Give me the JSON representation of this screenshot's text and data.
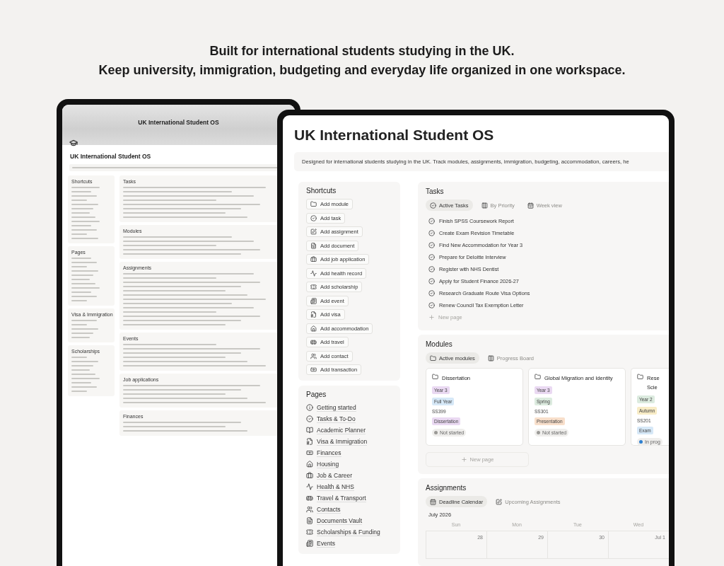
{
  "headline": [
    "Built for international students studying in the UK.",
    "Keep university, immigration, budgeting and everyday life organized in one workspace."
  ],
  "back_tablet": {
    "banner_title": "UK International Student OS",
    "page_title": "UK International Student OS",
    "sidebar": [
      {
        "title": "Shortcuts"
      },
      {
        "title": "Pages"
      },
      {
        "title": "Visa & Immigration"
      },
      {
        "title": "Scholarships"
      }
    ],
    "main": [
      {
        "title": "Tasks"
      },
      {
        "title": "Modules"
      },
      {
        "title": "Assignments"
      },
      {
        "title": "Events"
      },
      {
        "title": "Job applications"
      },
      {
        "title": "Finances"
      }
    ]
  },
  "front_tablet": {
    "title": "UK International Student OS",
    "description": "Designed for international students studying in the UK. Track modules, assignments, immigration, budgeting, accommodation, careers, he",
    "shortcuts": {
      "title": "Shortcuts",
      "items": [
        "Add module",
        "Add task",
        "Add assignment",
        "Add document",
        "Add job application",
        "Add health record",
        "Add scholarship",
        "Add event",
        "Add visa",
        "Add accommodation",
        "Add travel",
        "Add contact",
        "Add transaction"
      ]
    },
    "pages": {
      "title": "Pages",
      "items": [
        "Getting started",
        "Tasks & To-Do",
        "Academic Planner",
        "Visa & Immigration",
        "Finances",
        "Housing",
        "Job & Career",
        "Health & NHS",
        "Travel & Transport",
        "Contacts",
        "Documents Vault",
        "Scholarships & Funding",
        "Events"
      ]
    },
    "tasks": {
      "title": "Tasks",
      "views": [
        {
          "label": "Active Tasks",
          "selected": true
        },
        {
          "label": "By Priority",
          "selected": false
        },
        {
          "label": "Week view",
          "selected": false
        }
      ],
      "items": [
        "Finish SPSS Coursework Report",
        "Create Exam Revision Timetable",
        "Find New Accommodation for Year 3",
        "Prepare for Deloitte Interview",
        "Register with NHS Dentist",
        "Apply for Student Finance 2026-27",
        "Research Graduate Route Visa Options",
        "Renew Council Tax Exemption Letter"
      ],
      "new_page": "New page"
    },
    "modules": {
      "title": "Modules",
      "views": [
        {
          "label": "Active modules",
          "selected": true
        },
        {
          "label": "Progress Board",
          "selected": false
        }
      ],
      "cards": [
        {
          "title_lines": [
            "Dissertation"
          ],
          "tags": [
            {
              "label": "Year 3",
              "color": "#ead9f2"
            },
            {
              "label": "Full Year",
              "color": "#d6e8f7"
            }
          ],
          "code": "SS399",
          "type_tags": [
            {
              "label": "Dissertation",
              "color": "#ead9f2"
            }
          ],
          "status": {
            "label": "Not started",
            "color": "#9b9a97"
          }
        },
        {
          "title_lines": [
            "Global Migration and Identity"
          ],
          "tags": [
            {
              "label": "Year 3",
              "color": "#ead9f2"
            },
            {
              "label": "Spring",
              "color": "#dcebdf"
            }
          ],
          "code": "SS301",
          "type_tags": [
            {
              "label": "Presentation",
              "color": "#f8dfcb"
            }
          ],
          "status": {
            "label": "Not started",
            "color": "#9b9a97"
          }
        },
        {
          "title_lines": [
            "Rese",
            "Scie"
          ],
          "tags": [
            {
              "label": "Year 2",
              "color": "#dcebdf"
            },
            {
              "label": "Autumn",
              "color": "#f8ecc6"
            }
          ],
          "code": "SS201",
          "type_tags": [
            {
              "label": "Exam",
              "color": "#d6e8f7"
            }
          ],
          "status": {
            "label": "In prog",
            "color": "#2f80d0"
          }
        }
      ],
      "new_page": "New page"
    },
    "assignments": {
      "title": "Assignments",
      "views": [
        {
          "label": "Deadline Calendar",
          "selected": true
        },
        {
          "label": "Upcoming Assignments",
          "selected": false
        }
      ],
      "month": "July 2026",
      "weekdays": [
        "Sun",
        "Mon",
        "Tue",
        "Wed"
      ],
      "dates": [
        "28",
        "29",
        "30",
        "Jul 1"
      ]
    }
  }
}
